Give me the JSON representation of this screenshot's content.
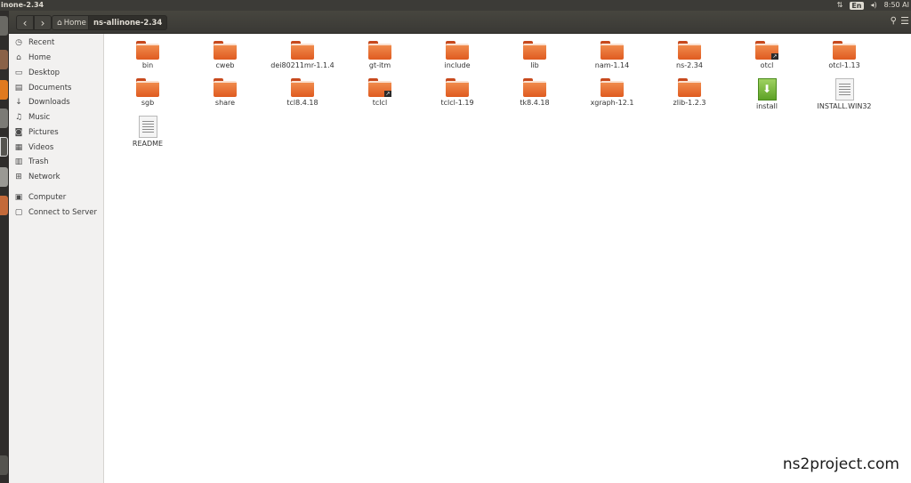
{
  "window": {
    "title": "inone-2.34"
  },
  "tray": {
    "network_icon": "updown-arrows-icon",
    "keyboard_layout": "En",
    "volume_icon": "speaker-icon",
    "time": "8:50 AI"
  },
  "toolbar": {
    "back_icon": "‹",
    "forward_icon": "›",
    "home_label": "Home",
    "current_folder": "ns-allinone-2.34",
    "search_icon": "⚲",
    "menu_icon": "☰"
  },
  "sidebar": {
    "items": [
      {
        "label": "Recent",
        "icon": "clock-icon",
        "glyph": "◷"
      },
      {
        "label": "Home",
        "icon": "home-icon",
        "glyph": "⌂"
      },
      {
        "label": "Desktop",
        "icon": "desktop-icon",
        "glyph": "▭"
      },
      {
        "label": "Documents",
        "icon": "documents-icon",
        "glyph": "▤"
      },
      {
        "label": "Downloads",
        "icon": "download-icon",
        "glyph": "↓"
      },
      {
        "label": "Music",
        "icon": "music-icon",
        "glyph": "♫"
      },
      {
        "label": "Pictures",
        "icon": "camera-icon",
        "glyph": "◙"
      },
      {
        "label": "Videos",
        "icon": "film-icon",
        "glyph": "▦"
      },
      {
        "label": "Trash",
        "icon": "trash-icon",
        "glyph": "▥"
      },
      {
        "label": "Network",
        "icon": "network-icon",
        "glyph": "⊞"
      },
      {
        "label": "Computer",
        "icon": "computer-icon",
        "glyph": "▣"
      },
      {
        "label": "Connect to Server",
        "icon": "server-icon",
        "glyph": "▢"
      }
    ]
  },
  "files": [
    {
      "name": "bin",
      "type": "folder"
    },
    {
      "name": "cweb",
      "type": "folder"
    },
    {
      "name": "dei80211mr-1.1.4",
      "type": "folder"
    },
    {
      "name": "gt-itm",
      "type": "folder"
    },
    {
      "name": "include",
      "type": "folder"
    },
    {
      "name": "lib",
      "type": "folder"
    },
    {
      "name": "nam-1.14",
      "type": "folder"
    },
    {
      "name": "ns-2.34",
      "type": "folder"
    },
    {
      "name": "otcl",
      "type": "folder-link"
    },
    {
      "name": "otcl-1.13",
      "type": "folder"
    },
    {
      "name": "sgb",
      "type": "folder"
    },
    {
      "name": "share",
      "type": "folder"
    },
    {
      "name": "tcl8.4.18",
      "type": "folder"
    },
    {
      "name": "tclcl",
      "type": "folder-link"
    },
    {
      "name": "tclcl-1.19",
      "type": "folder"
    },
    {
      "name": "tk8.4.18",
      "type": "folder"
    },
    {
      "name": "xgraph-12.1",
      "type": "folder"
    },
    {
      "name": "zlib-1.2.3",
      "type": "folder"
    },
    {
      "name": "install",
      "type": "executable"
    },
    {
      "name": "INSTALL.WIN32",
      "type": "document"
    },
    {
      "name": "README",
      "type": "document"
    }
  ],
  "watermark": "ns2project.com",
  "colors": {
    "folder_orange": "#e8672a",
    "panel_dark": "#3c3b37",
    "sidebar_bg": "#f2f1f0"
  }
}
